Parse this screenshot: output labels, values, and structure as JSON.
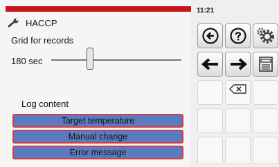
{
  "header": {
    "title": "HACCP",
    "title_icon": "wrench-icon",
    "accent_color": "#c8141d"
  },
  "settings": {
    "grid_label": "Grid for records",
    "grid_value": "180 sec"
  },
  "log": {
    "heading": "Log content",
    "items": [
      {
        "label": "Target temperature"
      },
      {
        "label": "Manual change"
      },
      {
        "label": "Error message"
      }
    ]
  },
  "status": {
    "time": "11:21"
  },
  "keypad": {
    "icons": [
      "back-circle-icon",
      "help-icon",
      "settings-gear-icon",
      "arrow-left-icon",
      "arrow-right-icon",
      "save-icon",
      "backspace-icon"
    ]
  }
}
